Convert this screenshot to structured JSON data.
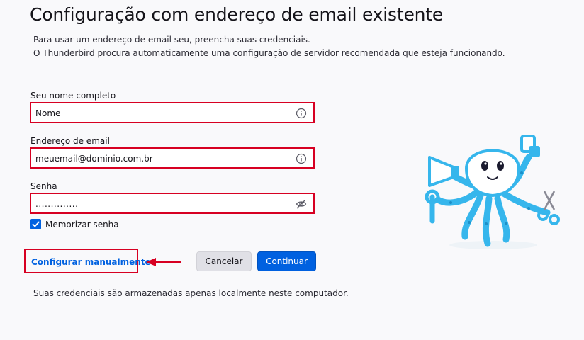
{
  "page": {
    "title": "Configuração com endereço de email existente",
    "description_line1": "Para usar um endereço de email seu, preencha suas credenciais.",
    "description_line2": "O Thunderbird procura automaticamente uma configuração de servidor recomendada que esteja funcionando."
  },
  "form": {
    "name": {
      "label": "Seu nome completo",
      "value": "Nome",
      "icon": "info-icon"
    },
    "email": {
      "label": "Endereço de email",
      "value": "meuemail@dominio.com.br",
      "icon": "info-icon"
    },
    "password": {
      "label": "Senha",
      "value": "..............",
      "icon": "eye-slash-icon"
    },
    "remember": {
      "label": "Memorizar senha",
      "checked": true
    }
  },
  "actions": {
    "manual_label": "Configurar manualmente",
    "cancel_label": "Cancelar",
    "continue_label": "Continuar"
  },
  "footer": {
    "note": "Suas credenciais são armazenadas apenas localmente neste computador."
  },
  "colors": {
    "accent": "#0061e0",
    "highlight": "#d70022",
    "mascot": "#36b6ec"
  }
}
